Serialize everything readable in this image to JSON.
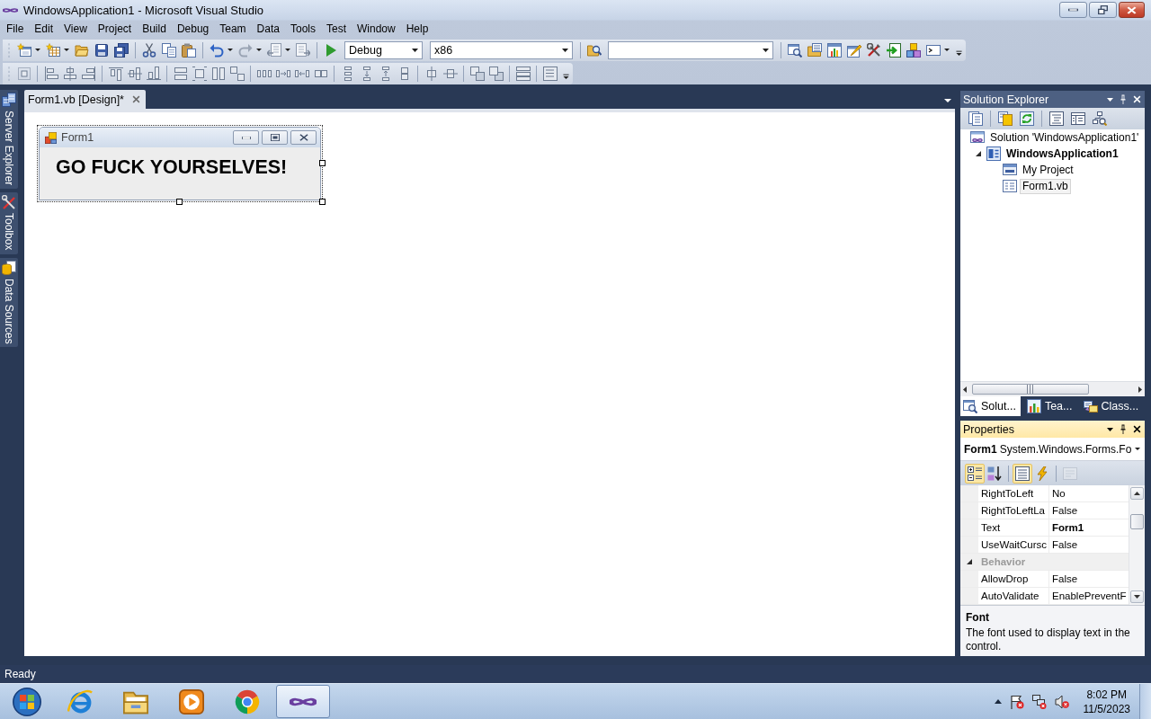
{
  "window": {
    "title": "WindowsApplication1 - Microsoft Visual Studio"
  },
  "menu": [
    "File",
    "Edit",
    "View",
    "Project",
    "Build",
    "Debug",
    "Team",
    "Data",
    "Tools",
    "Test",
    "Window",
    "Help"
  ],
  "toolbar": {
    "configuration": "Debug",
    "platform": "x86"
  },
  "side_tabs": [
    "Server Explorer",
    "Toolbox",
    "Data Sources"
  ],
  "document_tabs": [
    {
      "label": "Form1.vb [Design]*",
      "selected": true
    }
  ],
  "designer": {
    "form": {
      "title": "Form1",
      "label": "GO FUCK YOURSELVES!"
    }
  },
  "solution_explorer": {
    "title": "Solution Explorer",
    "active": false,
    "tree": [
      {
        "label": "Solution 'WindowsApplication1'",
        "kind": "solution",
        "selected": false,
        "children": [
          {
            "label": "WindowsApplication1",
            "kind": "project",
            "selected": false,
            "expanded": true,
            "children": [
              {
                "label": "My Project",
                "kind": "settings",
                "selected": false
              },
              {
                "label": "Form1.vb",
                "kind": "form",
                "selected": true
              }
            ]
          }
        ]
      }
    ],
    "tabs": [
      {
        "label": "Solut...",
        "kind": "solution",
        "selected": true
      },
      {
        "label": "Tea...",
        "kind": "team",
        "selected": false
      },
      {
        "label": "Class...",
        "kind": "class",
        "selected": false
      }
    ]
  },
  "properties": {
    "title": "Properties",
    "active": true,
    "object": {
      "name": "Form1",
      "type": "System.Windows.Forms.Fo"
    },
    "view_buttons": [
      {
        "kind": "categorized",
        "selected": true,
        "disabled": false
      },
      {
        "kind": "alphabetical",
        "selected": false,
        "disabled": false
      },
      {
        "kind": "properties",
        "selected": true,
        "disabled": false
      },
      {
        "kind": "events",
        "selected": false,
        "disabled": false
      },
      {
        "kind": "pages",
        "selected": false,
        "disabled": true
      }
    ],
    "rows": [
      {
        "kind": "property",
        "name": "RightToLeft",
        "value": "No",
        "modified": false
      },
      {
        "kind": "property",
        "name": "RightToLeftLa",
        "value": "False",
        "modified": false
      },
      {
        "kind": "property",
        "name": "Text",
        "value": "Form1",
        "modified": true
      },
      {
        "kind": "property",
        "name": "UseWaitCursc",
        "value": "False",
        "modified": false
      },
      {
        "kind": "category",
        "name": "Behavior",
        "expanded": true
      },
      {
        "kind": "property",
        "name": "AllowDrop",
        "value": "False",
        "modified": false
      },
      {
        "kind": "property",
        "name": "AutoValidate",
        "value": "EnablePreventF",
        "modified": false
      }
    ],
    "description": {
      "title": "Font",
      "text": "The font used to display text in the control."
    }
  },
  "status_bar": {
    "text": "Ready"
  },
  "taskbar": {
    "apps": [
      {
        "kind": "globe",
        "selected": false
      },
      {
        "kind": "folder",
        "selected": false
      },
      {
        "kind": "player",
        "selected": false
      },
      {
        "kind": "wheel",
        "selected": false
      },
      {
        "kind": "infinity",
        "selected": true
      }
    ],
    "clock": {
      "time": "8:02 PM",
      "date": "11/5/2023"
    }
  }
}
